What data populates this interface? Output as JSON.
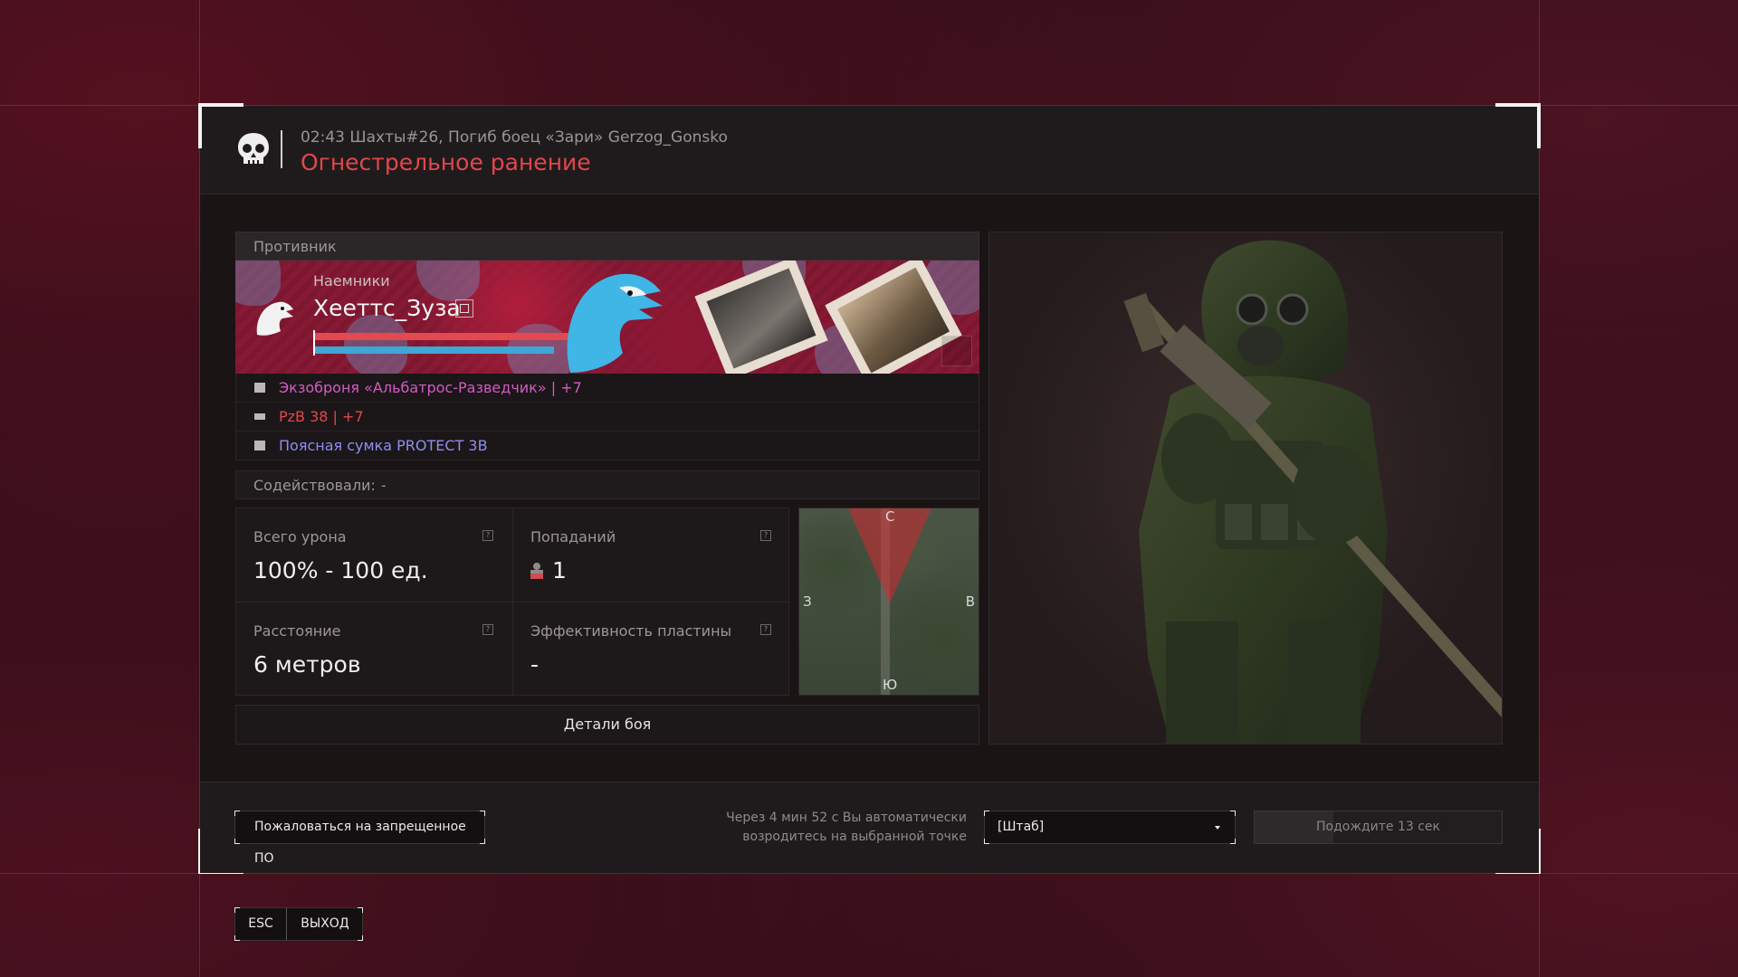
{
  "header": {
    "meta": "02:43 Шахты#26, Погиб боец «Зари» Gerzog_Gonsko",
    "cause": "Огнестрельное ранение"
  },
  "enemy": {
    "section_title": "Противник",
    "faction": "Наемники",
    "player_name": "Хееттс_Зуза",
    "health_fraction": 0.83,
    "armor_fraction": 0.76
  },
  "equipment": [
    {
      "icon": "armor-icon",
      "name": "Экзоброня «Альбатрос-Разведчик»",
      "sep": " | ",
      "level": "+7",
      "color": "#d35bc5"
    },
    {
      "icon": "rifle-icon",
      "name": "PzB 38",
      "sep": " | ",
      "level": "+7",
      "color": "#e2474d"
    },
    {
      "icon": "pouch-icon",
      "name": "Поясная сумка PROTECT 3B",
      "sep": "",
      "level": "",
      "color": "#8f8ef0"
    }
  ],
  "assist": {
    "label": "Содействовали:",
    "value": "-"
  },
  "stats": {
    "total_damage": {
      "label": "Всего урона",
      "value": "100% - 100 ед."
    },
    "hits": {
      "label": "Попаданий",
      "value": "1"
    },
    "distance": {
      "label": "Расстояние",
      "value": "6 метров"
    },
    "plate_eff": {
      "label": "Эффективность пластины",
      "value": "-"
    },
    "help": "?"
  },
  "minimap": {
    "north": "С",
    "west": "З",
    "east": "В",
    "south": "Ю"
  },
  "details_button": "Детали боя",
  "footer": {
    "report_button": "Пожаловаться на запрещенное ПО",
    "respawn_note_line1": "Через 4 мин 52 с Вы автоматически",
    "respawn_note_line2": "возродитесь на выбранной точке",
    "spawn_point": "[Штаб]",
    "wait_button": "Подождите 13 сек",
    "wait_progress": 0.32
  },
  "exit": {
    "key": "ESC",
    "label": "ВЫХОД"
  },
  "colors": {
    "accent_red": "#e0474c",
    "health": "#e24a50",
    "armor": "#3fa7d6"
  }
}
